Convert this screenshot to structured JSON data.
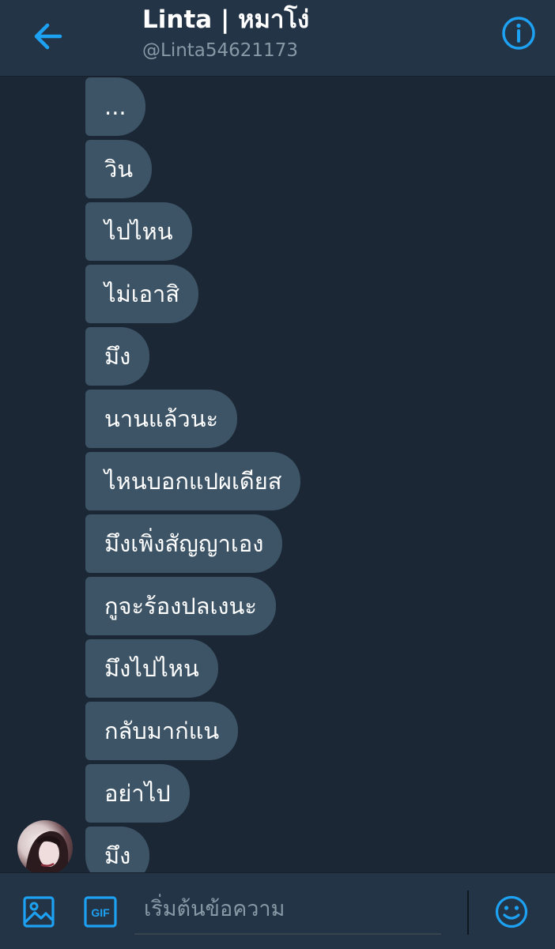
{
  "header": {
    "back_icon": "arrow-left-icon",
    "title": "Linta | หมาโง่",
    "handle": "@Linta54621173",
    "info_icon": "info-icon"
  },
  "colors": {
    "accent": "#1da1f2",
    "header_bg": "#243447",
    "body_bg": "#1b2735",
    "bubble_bg": "#3d5466",
    "muted_text": "#8899a6"
  },
  "messages": [
    {
      "text": "..."
    },
    {
      "text": "วิน"
    },
    {
      "text": "ไปไหน"
    },
    {
      "text": "ไม่เอาสิ"
    },
    {
      "text": "มึง"
    },
    {
      "text": "นานแล้วนะ"
    },
    {
      "text": "ไหนบอกแปผเดียส"
    },
    {
      "text": "มึงเพิ่งสัญญาเอง"
    },
    {
      "text": "กูจะร้องปลเงนะ"
    },
    {
      "text": "มึงไปไหน"
    },
    {
      "text": "กลับมาก่แน"
    },
    {
      "text": "อย่าไป"
    },
    {
      "text": "มึง"
    }
  ],
  "composer": {
    "placeholder": "เริ่มต้นข้อความ",
    "image_icon": "image-icon",
    "gif_label": "GIF",
    "emoji_icon": "emoji-icon"
  }
}
